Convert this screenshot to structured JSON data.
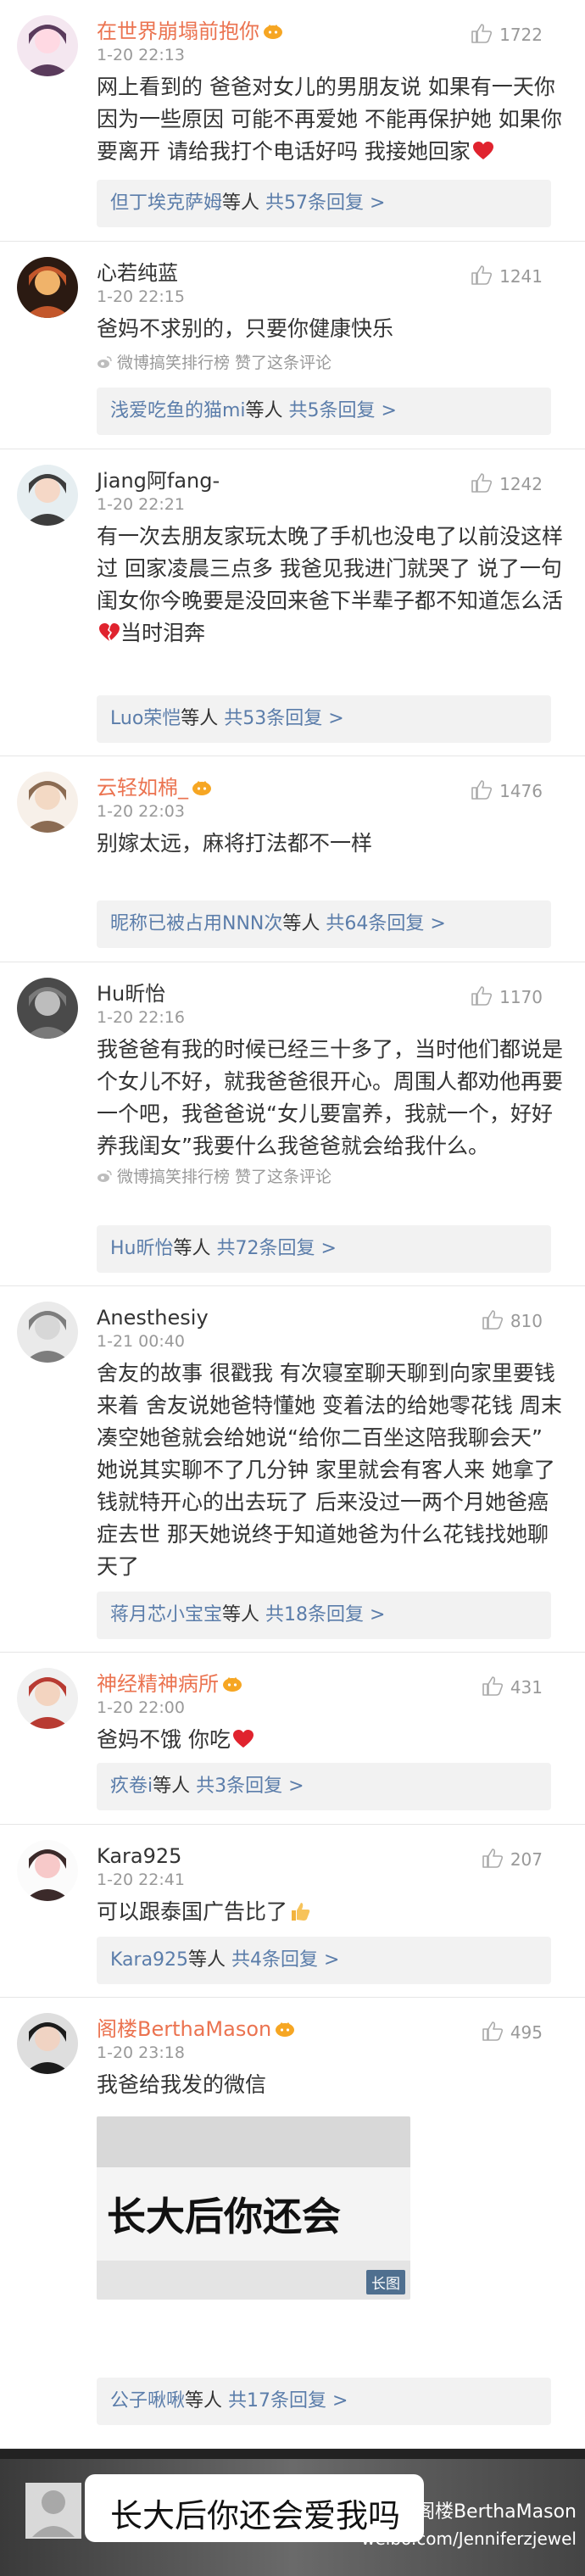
{
  "comments": [
    {
      "name": "在世界崩塌前抱你",
      "vip": true,
      "time": "1-20 22:13",
      "likes": "1722",
      "lines": [
        "网上看到的 爸爸对女儿的男朋友说 如果有一天你",
        "因为一些原因 可能不再爱她 不能再保护她 如果你",
        "要离开 请给我打个电话好吗 我接她回家"
      ],
      "heart_after_last": true,
      "via": "",
      "reply_name": "但丁埃克萨姆",
      "reply_sep": "等人 ",
      "reply_count": "共57条回复 >"
    },
    {
      "name": "心若纯蓝",
      "vip": false,
      "time": "1-20 22:15",
      "likes": "1241",
      "lines": [
        "爸妈不求别的，只要你健康快乐"
      ],
      "heart_after_last": false,
      "via": "微博搞笑排行榜 赞了这条评论",
      "reply_name": "浅爱吃鱼的猫mi",
      "reply_sep": "等人 ",
      "reply_count": "共5条回复 >"
    },
    {
      "name": "Jiang阿fang-",
      "vip": false,
      "time": "1-20 22:21",
      "likes": "1242",
      "lines": [
        "有一次去朋友家玩太晚了手机也没电了以前没这样",
        "过 回家凌晨三点多 我爸见我进门就哭了 说了一句",
        "闺女你今晚要是没回来爸下半辈子都不知道怎么活",
        "当时泪奔"
      ],
      "heart_after_last": false,
      "broken_heart_line": 3,
      "via": "",
      "reply_name": "Luo荣恺",
      "reply_sep": "等人 ",
      "reply_count": "共53条回复 >"
    },
    {
      "name": "云轻如棉_",
      "vip": true,
      "time": "1-20 22:03",
      "likes": "1476",
      "lines": [
        "别嫁太远，麻将打法都不一样"
      ],
      "heart_after_last": false,
      "via": "",
      "reply_name": "昵称已被占用NNN次",
      "reply_sep": "等人 ",
      "reply_count": "共64条回复 >"
    },
    {
      "name": "Hu昕怡",
      "vip": false,
      "time": "1-20 22:16",
      "likes": "1170",
      "lines": [
        "我爸爸有我的时候已经三十多了，当时他们都说是",
        "个女儿不好，就我爸爸很开心。周围人都劝他再要",
        "一个吧，我爸爸说“女儿要富养，我就一个，好好",
        "养我闺女”我要什么我爸爸就会给我什么。"
      ],
      "heart_after_last": false,
      "via": "微博搞笑排行榜 赞了这条评论",
      "reply_name": "Hu昕怡",
      "reply_sep": "等人 ",
      "reply_count": "共72条回复 >"
    },
    {
      "name": "Anesthesiy",
      "vip": false,
      "time": "1-21 00:40",
      "likes": "810",
      "lines": [
        "舍友的故事 很戳我 有次寝室聊天聊到向家里要钱",
        "来着 舍友说她爸特懂她 变着法的给她零花钱 周末",
        "凑空她爸就会给她说“给你二百坐这陪我聊会天”",
        "她说其实聊不了几分钟 家里就会有客人来 她拿了",
        "钱就特开心的出去玩了 后来没过一两个月她爸癌",
        "症去世 那天她说终于知道她爸为什么花钱找她聊",
        "天了"
      ],
      "heart_after_last": false,
      "via": "",
      "reply_name": "蒋月芯小宝宝",
      "reply_sep": "等人 ",
      "reply_count": "共18条回复 >"
    },
    {
      "name": "神经精神病所",
      "vip": true,
      "time": "1-20 22:00",
      "likes": "431",
      "lines": [
        "爸妈不饿 你吃"
      ],
      "heart_after_last": true,
      "via": "",
      "reply_name": "疚卷i",
      "reply_sep": "等人 ",
      "reply_count": "共3条回复 >"
    },
    {
      "name": "Kara925",
      "vip": false,
      "time": "1-20 22:41",
      "likes": "207",
      "lines": [
        "可以跟泰国广告比了"
      ],
      "heart_after_last": false,
      "thumb_after_last": true,
      "via": "",
      "reply_name": "Kara925",
      "reply_sep": "等人 ",
      "reply_count": "共4条回复 >"
    },
    {
      "name": "阁楼BerthaMason",
      "vip": true,
      "time": "1-20 23:18",
      "likes": "495",
      "lines": [
        "我爸给我发的微信"
      ],
      "heart_after_last": false,
      "via": "",
      "reply_name": "公子啾啾",
      "reply_sep": "等人 ",
      "reply_count": "共17条回复 >"
    }
  ],
  "image_caption": "长大后你还会",
  "long_image_tag": "长图",
  "banner": {
    "message": "长大后你还会爱我吗",
    "watermark_line1": "@阁楼BerthaMason",
    "watermark_line2": "weibo.com/Jenniferzjewel"
  },
  "colors": {
    "vip_name": "#eb7350",
    "reply_link": "#5b7daa",
    "meta": "#999999",
    "heart": "#e0232e"
  }
}
